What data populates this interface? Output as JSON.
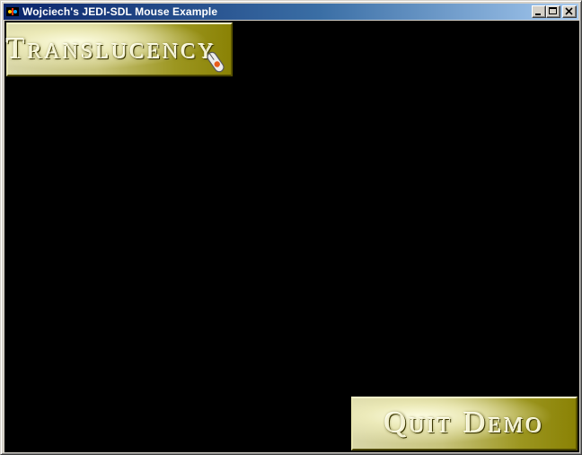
{
  "window": {
    "title": "Wojciech's JEDI-SDL Mouse Example",
    "icon": "jedi-sdl-app-icon",
    "controls": {
      "minimize_icon": "minimize-icon",
      "maximize_icon": "maximize-icon",
      "close_icon": "close-icon"
    }
  },
  "canvas": {
    "background": "#000000",
    "buttons": {
      "translucency": {
        "label": "Translucency"
      },
      "quit": {
        "label": "Quit Demo"
      }
    },
    "cursor_icon": "mouse-cursor-icon"
  },
  "colors": {
    "titlebar_start": "#0a246a",
    "titlebar_end": "#a6caf0",
    "button_gold": "#9c9620"
  }
}
